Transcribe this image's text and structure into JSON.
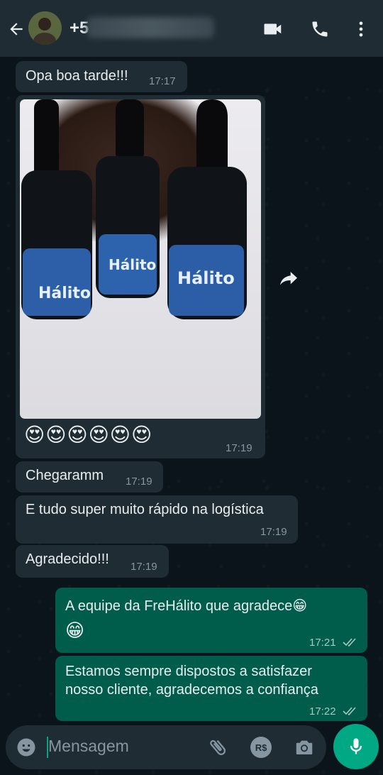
{
  "header": {
    "contact_prefix": "+5",
    "back_icon": "arrow-left-icon",
    "video_icon": "video-camera-icon",
    "call_icon": "phone-icon",
    "menu_icon": "more-vert-icon"
  },
  "messages": [
    {
      "direction": "in",
      "text": "Opa boa tarde!!!",
      "time": "17:17"
    },
    {
      "direction": "in",
      "type": "image",
      "caption": "😍😍😍😍😍😍",
      "time": "17:19",
      "image_label": "Hálito"
    },
    {
      "direction": "in",
      "text": "Chegaramm",
      "time": "17:19"
    },
    {
      "direction": "in",
      "text": "E tudo super muito rápido na logística",
      "time": "17:19"
    },
    {
      "direction": "in",
      "text": "Agradecido!!!",
      "time": "17:19"
    },
    {
      "direction": "out",
      "text_line1": "A equipe da FreHálito que agradece😁",
      "text_line2": "😁",
      "time": "17:21"
    },
    {
      "direction": "out",
      "text_line1": "Estamos sempre dispostos a satisfazer",
      "text_line2": "nosso cliente, agradecemos a confiança",
      "time": "17:22"
    }
  ],
  "composer": {
    "placeholder": "Mensagem",
    "emoji_icon": "emoji-icon",
    "attach_icon": "paperclip-icon",
    "payment_icon": "real-currency-icon",
    "payment_label": "R$",
    "camera_icon": "camera-icon",
    "mic_icon": "microphone-icon"
  },
  "colors": {
    "header_bg": "#1f2c34",
    "incoming_bubble": "#1f2c34",
    "outgoing_bubble": "#005c4b",
    "accent": "#00a884",
    "chat_bg": "#0b141a"
  }
}
